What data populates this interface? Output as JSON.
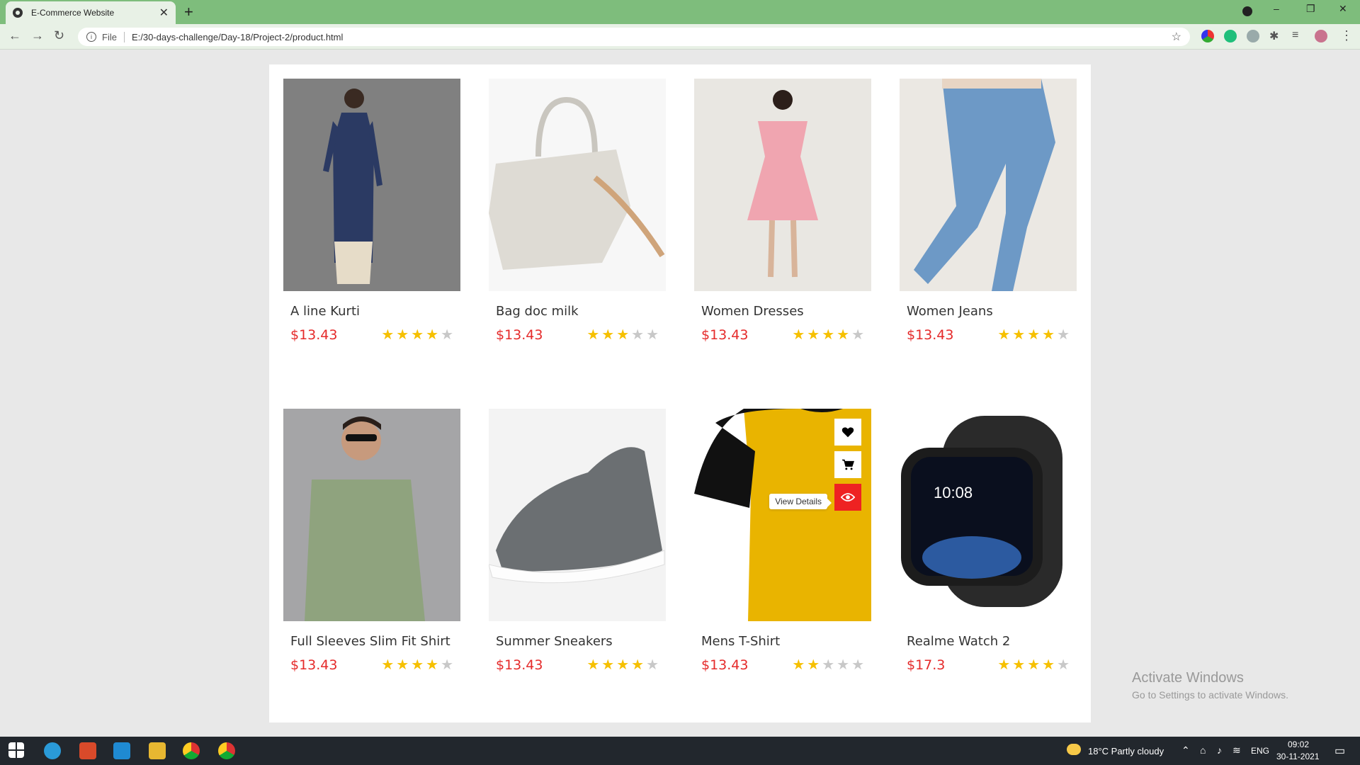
{
  "browser": {
    "tab_title": "E-Commerce Website",
    "tab_close": "✕",
    "new_tab": "+",
    "scheme": "File",
    "url": "E:/30-days-challenge/Day-18/Project-2/product.html"
  },
  "products": [
    {
      "name": "A line Kurti",
      "price": "$13.43",
      "rating": 4
    },
    {
      "name": "Bag doc milk",
      "price": "$13.43",
      "rating": 3
    },
    {
      "name": "Women Dresses",
      "price": "$13.43",
      "rating": 4
    },
    {
      "name": "Women Jeans",
      "price": "$13.43",
      "rating": 4
    },
    {
      "name": "Full Sleeves Slim Fit Shirt",
      "price": "$13.43",
      "rating": 4
    },
    {
      "name": "Summer Sneakers",
      "price": "$13.43",
      "rating": 4
    },
    {
      "name": "Mens T-Shirt",
      "price": "$13.43",
      "rating": 2
    },
    {
      "name": "Realme Watch 2",
      "price": "$17.3",
      "rating": 4
    }
  ],
  "hover": {
    "tooltip": "View Details"
  },
  "watermark": {
    "line1": "Activate Windows",
    "line2": "Go to Settings to activate Windows."
  },
  "taskbar": {
    "weather": "18°C  Partly cloudy",
    "language": "ENG",
    "time": "09:02",
    "date": "30-11-2021"
  },
  "colors": {
    "price": "#e52a2a",
    "star_on": "#f6c000",
    "star_off": "#c8c8c8",
    "accent": "#ee2222",
    "chrome": "#7ebd7c"
  }
}
